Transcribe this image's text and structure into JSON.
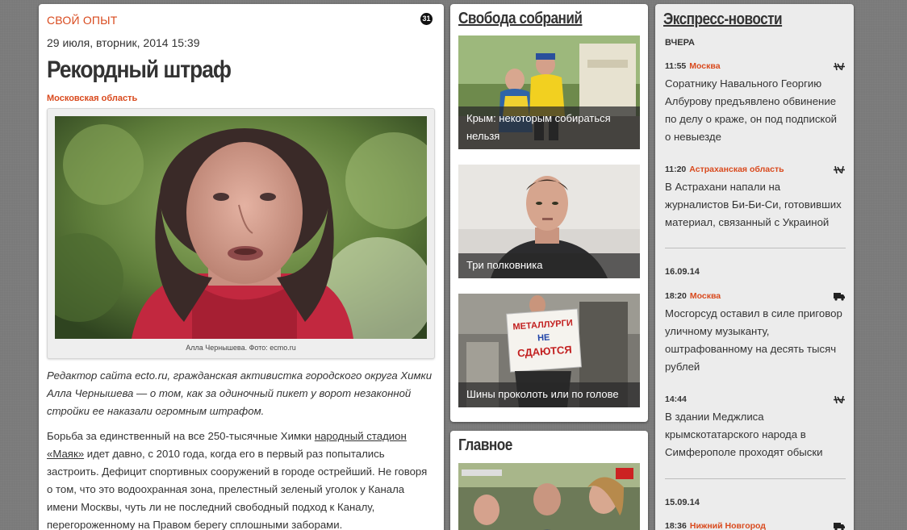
{
  "article": {
    "section": "СВОЙ ОПЫТ",
    "counter": "31",
    "date": "29 июля, вторник, 2014 15:39",
    "title": "Рекордный штраф",
    "region": "Московская область",
    "caption": "Алла Чернышева. Фото: ecmo.ru",
    "lead": "Редактор сайта ecto.ru, гражданская активистка городского округа Химки Алла Чернышева — о том, как за одиночный пикет у ворот незаконной стройки ее наказали огромным штрафом.",
    "body_before_link": "Борьба за единственный на все 250-тысячные Химки ",
    "body_link": "народный стадион «Маяк»",
    "body_after_link": " идет давно, с 2010 года, когда его в первый раз попытались застроить. Дефицит спортивных сооружений в городе острейший. Не говоря о том, что это водоохранная зона, прелестный зеленый уголок у Канала имени Москвы, чуть ли не последний свободный подход к Каналу, перегороженному на Правом берегу сплошными заборами."
  },
  "svoboda": {
    "title": "Свобода собраний",
    "cards": [
      {
        "caption": "Крым: некоторым собираться нельзя"
      },
      {
        "caption": "Три полковника"
      },
      {
        "caption": "Шины проколоть или по голове",
        "sign": [
          "МЕТАЛЛУРГИ",
          "НЕ",
          "СДАЮТСЯ"
        ]
      }
    ]
  },
  "glavnoe": {
    "title": "Главное"
  },
  "express": {
    "title": "Экспресс-новости",
    "days": [
      {
        "label": "ВЧЕРА",
        "items": [
          {
            "time": "11:55",
            "region": "Москва",
            "icon": "gavel-icon",
            "text": "Соратнику Навального Георгию Албурову предъявлено обвинение по делу о краже, он под подпиской о невыезде"
          },
          {
            "time": "11:20",
            "region": "Астраханская область",
            "icon": "gavel-icon",
            "text": "В Астрахани напали на журналистов Би-Би-Си, готовивших материал, связанный с Украиной"
          }
        ]
      },
      {
        "label": "16.09.14",
        "items": [
          {
            "time": "18:20",
            "region": "Москва",
            "icon": "truck-icon",
            "text": "Мосгорсуд оставил в силе приговор уличному музыканту, оштрафованному на десять тысяч рублей"
          },
          {
            "time": "14:44",
            "region": "",
            "icon": "gavel-icon",
            "text": "В здании Меджлиса крымскотатарского народа в Симферополе проходят обыски"
          }
        ]
      },
      {
        "label": "15.09.14",
        "items": [
          {
            "time": "18:36",
            "region": "Нижний Новгород",
            "icon": "truck-icon",
            "text": ""
          }
        ]
      }
    ]
  },
  "colors": {
    "accent": "#d94a1e",
    "text": "#333333",
    "background": "#7a7a7a"
  }
}
